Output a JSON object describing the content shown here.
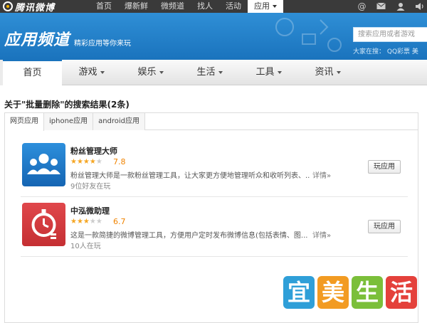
{
  "topbar": {
    "logo_text": "腾讯微博",
    "nav": [
      "首页",
      "爆新鲜",
      "微频道",
      "找人",
      "活动",
      "应用"
    ],
    "active_nav": 5,
    "icons": [
      "at-icon",
      "mail-icon",
      "user-icon",
      "sound-icon"
    ]
  },
  "banner": {
    "title": "应用频道",
    "slogan": "精彩应用等你来玩",
    "search_placeholder": "搜索应用或者游戏",
    "hot_search": "大家在搜：   QQ彩票  美"
  },
  "nav": {
    "items": [
      {
        "label": "首页",
        "dropdown": false
      },
      {
        "label": "游戏",
        "dropdown": true
      },
      {
        "label": "娱乐",
        "dropdown": true
      },
      {
        "label": "生活",
        "dropdown": true
      },
      {
        "label": "工具",
        "dropdown": true
      },
      {
        "label": "资讯",
        "dropdown": true
      }
    ],
    "active": 0
  },
  "results": {
    "title": "关于\"批量删除\"的搜索结果(2条)",
    "tabs": [
      "网页应用",
      "iphone应用",
      "android应用"
    ],
    "active_tab": 0,
    "apps": [
      {
        "name": "粉丝管理大师",
        "stars": 4,
        "rating": "7.8",
        "desc": "粉丝管理大师是一款粉丝管理工具，让大家更方便地管理听众和收听列表、...",
        "more": "详情»",
        "players": "9位好友在玩",
        "button": "玩应用",
        "icon": "fans-manager-icon",
        "icon_color": "#1c7cc9"
      },
      {
        "name": "中泓微助理",
        "stars": 3,
        "rating": "6.7",
        "desc": "这是一款简捷的微博管理工具，方便用户定时发布微博信息(包括表情、图...",
        "more": "详情»",
        "players": "10人在玩",
        "button": "玩应用",
        "icon": "timer-assistant-icon",
        "icon_color": "#d9373c"
      }
    ]
  },
  "watermark": {
    "chars": [
      "宜",
      "美",
      "生",
      "活"
    ],
    "colors": [
      "#2f9fd8",
      "#f29b22",
      "#7bbf3a",
      "#e4413b"
    ]
  }
}
